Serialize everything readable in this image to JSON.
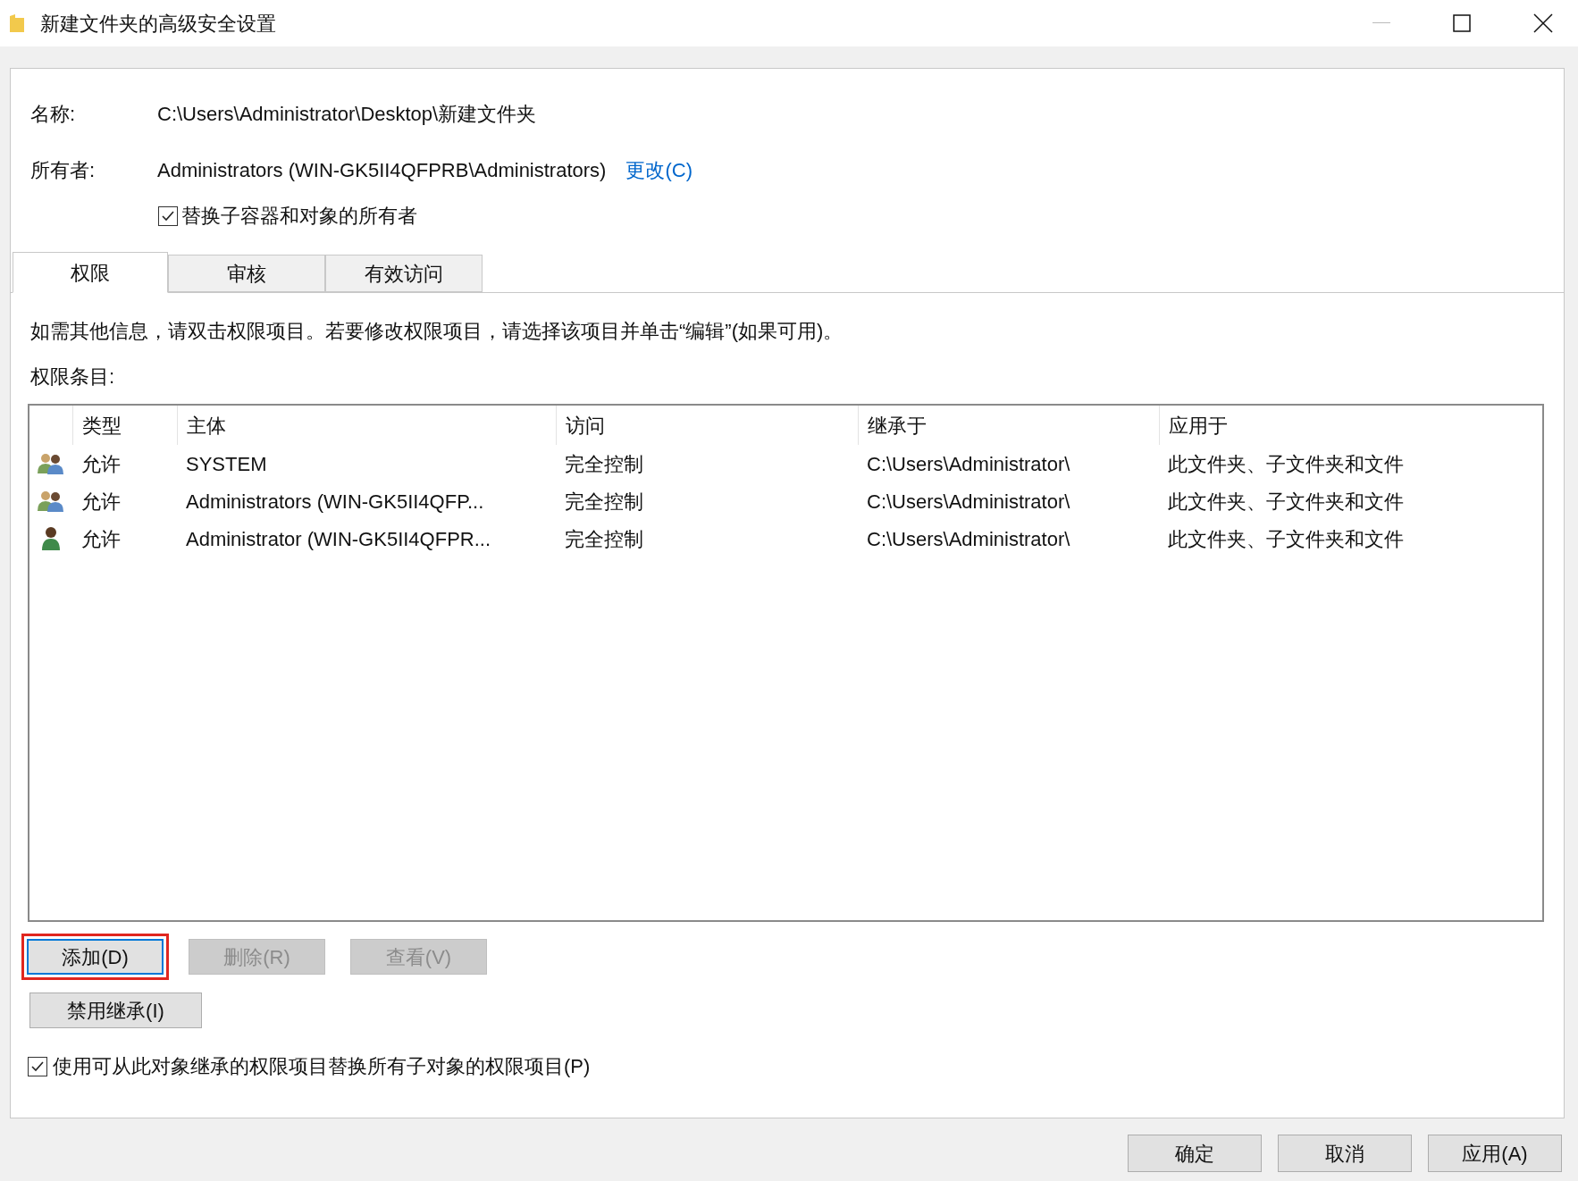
{
  "window": {
    "title": "新建文件夹的高级安全设置"
  },
  "name": {
    "label": "名称:",
    "value": "C:\\Users\\Administrator\\Desktop\\新建文件夹"
  },
  "owner": {
    "label": "所有者:",
    "value": "Administrators (WIN-GK5II4QFPRB\\Administrators)",
    "change_link": "更改(C)"
  },
  "replace_owner": {
    "label": "替换子容器和对象的所有者",
    "checked": true
  },
  "tabs": [
    {
      "label": "权限",
      "selected": true
    },
    {
      "label": "审核",
      "selected": false
    },
    {
      "label": "有效访问",
      "selected": false
    }
  ],
  "instruction": "如需其他信息，请双击权限项目。若要修改权限项目，请选择该项目并单击“编辑”(如果可用)。",
  "entries_label": "权限条目:",
  "table": {
    "columns": [
      "类型",
      "主体",
      "访问",
      "继承于",
      "应用于"
    ],
    "rows": [
      {
        "kind": "group",
        "type": "允许",
        "principal": "SYSTEM",
        "access": "完全控制",
        "inherited_from": "C:\\Users\\Administrator\\",
        "applies_to": "此文件夹、子文件夹和文件"
      },
      {
        "kind": "group",
        "type": "允许",
        "principal": "Administrators (WIN-GK5II4QFP...",
        "access": "完全控制",
        "inherited_from": "C:\\Users\\Administrator\\",
        "applies_to": "此文件夹、子文件夹和文件"
      },
      {
        "kind": "user",
        "type": "允许",
        "principal": "Administrator (WIN-GK5II4QFPR...",
        "access": "完全控制",
        "inherited_from": "C:\\Users\\Administrator\\",
        "applies_to": "此文件夹、子文件夹和文件"
      }
    ]
  },
  "entry_buttons": [
    {
      "label": "添加(D)",
      "disabled": false,
      "highlighted": true
    },
    {
      "label": "删除(R)",
      "disabled": true,
      "highlighted": false
    },
    {
      "label": "查看(V)",
      "disabled": true,
      "highlighted": false
    }
  ],
  "disable_inheritance_button": "禁用继承(I)",
  "replace_child_permissions": {
    "label": "使用可从此对象继承的权限项目替换所有子对象的权限项目(P)",
    "checked": true
  },
  "footer_buttons": [
    "确定",
    "取消",
    "应用(A)"
  ]
}
